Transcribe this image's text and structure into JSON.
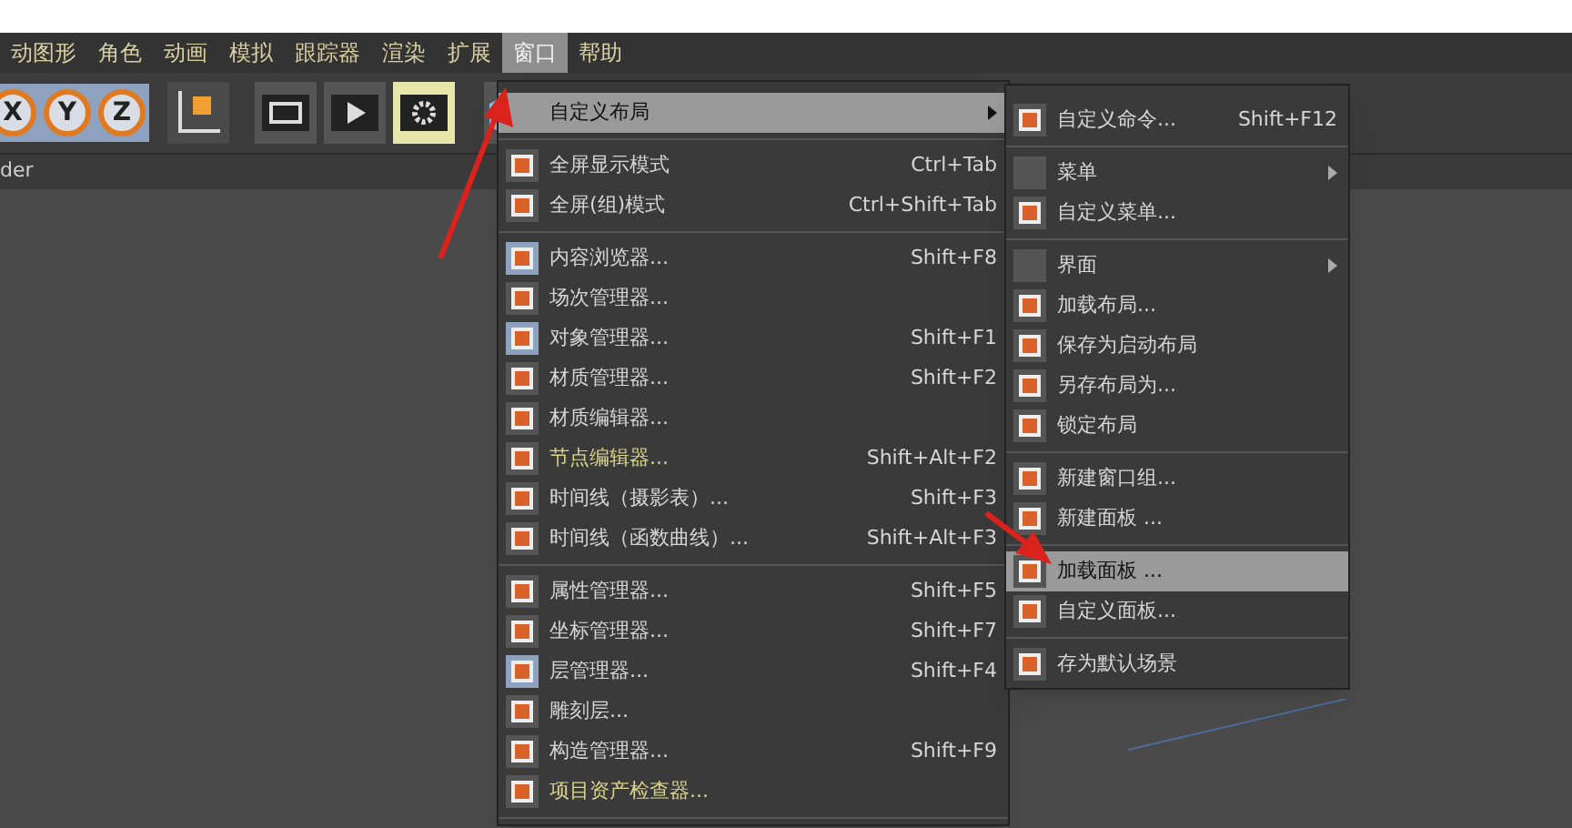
{
  "menubar": [
    {
      "label": "动图形",
      "selected": false
    },
    {
      "label": "角色",
      "selected": false
    },
    {
      "label": "动画",
      "selected": false
    },
    {
      "label": "模拟",
      "selected": false
    },
    {
      "label": "跟踪器",
      "selected": false
    },
    {
      "label": "渲染",
      "selected": false
    },
    {
      "label": "扩展",
      "selected": false
    },
    {
      "label": "窗口",
      "selected": true
    },
    {
      "label": "帮助",
      "selected": false
    }
  ],
  "toolbar": {
    "axis_buttons": [
      "X",
      "Y",
      "Z"
    ]
  },
  "panel_label": "der",
  "window_menu": [
    {
      "kind": "submenu",
      "label": "自定义布局",
      "selected": true,
      "accent": false
    },
    {
      "kind": "separator"
    },
    {
      "kind": "command",
      "label": "全屏显示模式",
      "shortcut": "Ctrl+Tab",
      "selected": false,
      "checked": false,
      "accent": false
    },
    {
      "kind": "command",
      "label": "全屏(组)模式",
      "shortcut": "Ctrl+Shift+Tab",
      "selected": false,
      "checked": false,
      "accent": false
    },
    {
      "kind": "separator"
    },
    {
      "kind": "command",
      "label": "内容浏览器...",
      "shortcut": "Shift+F8",
      "selected": false,
      "checked": true,
      "accent": false
    },
    {
      "kind": "command",
      "label": "场次管理器...",
      "selected": false,
      "checked": false,
      "accent": false
    },
    {
      "kind": "command",
      "label": "对象管理器...",
      "shortcut": "Shift+F1",
      "selected": false,
      "checked": true,
      "accent": false
    },
    {
      "kind": "command",
      "label": "材质管理器...",
      "shortcut": "Shift+F2",
      "selected": false,
      "checked": false,
      "accent": false
    },
    {
      "kind": "command",
      "label": "材质编辑器...",
      "selected": false,
      "checked": false,
      "accent": false
    },
    {
      "kind": "command",
      "label": "节点编辑器...",
      "shortcut": "Shift+Alt+F2",
      "selected": false,
      "checked": false,
      "accent": true
    },
    {
      "kind": "command",
      "label": "时间线（摄影表）...",
      "shortcut": "Shift+F3",
      "selected": false,
      "checked": false,
      "accent": false
    },
    {
      "kind": "command",
      "label": "时间线（函数曲线）...",
      "shortcut": "Shift+Alt+F3",
      "selected": false,
      "checked": false,
      "accent": false
    },
    {
      "kind": "separator"
    },
    {
      "kind": "command",
      "label": "属性管理器...",
      "shortcut": "Shift+F5",
      "selected": false,
      "checked": false,
      "accent": false
    },
    {
      "kind": "command",
      "label": "坐标管理器...",
      "shortcut": "Shift+F7",
      "selected": false,
      "checked": false,
      "accent": false
    },
    {
      "kind": "command",
      "label": "层管理器...",
      "shortcut": "Shift+F4",
      "selected": false,
      "checked": true,
      "accent": false
    },
    {
      "kind": "command",
      "label": "雕刻层...",
      "selected": false,
      "checked": false,
      "accent": false
    },
    {
      "kind": "command",
      "label": "构造管理器...",
      "shortcut": "Shift+F9",
      "selected": false,
      "checked": false,
      "accent": false
    },
    {
      "kind": "command",
      "label": "项目资产检查器...",
      "selected": false,
      "checked": false,
      "accent": true
    },
    {
      "kind": "separator"
    }
  ],
  "layout_submenu": [
    {
      "kind": "command",
      "label": "自定义命令...",
      "shortcut": "Shift+F12",
      "selected": false
    },
    {
      "kind": "separator"
    },
    {
      "kind": "submenu",
      "label": "菜单",
      "selected": false
    },
    {
      "kind": "command",
      "label": "自定义菜单...",
      "selected": false
    },
    {
      "kind": "separator"
    },
    {
      "kind": "submenu",
      "label": "界面",
      "selected": false
    },
    {
      "kind": "command",
      "label": "加载布局...",
      "selected": false
    },
    {
      "kind": "command",
      "label": "保存为启动布局",
      "selected": false
    },
    {
      "kind": "command",
      "label": "另存布局为...",
      "selected": false
    },
    {
      "kind": "command",
      "label": "锁定布局",
      "selected": false
    },
    {
      "kind": "separator"
    },
    {
      "kind": "command",
      "label": "新建窗口组...",
      "selected": false
    },
    {
      "kind": "command",
      "label": "新建面板 ...",
      "selected": false
    },
    {
      "kind": "separator"
    },
    {
      "kind": "command",
      "label": "加载面板 ...",
      "selected": true
    },
    {
      "kind": "command",
      "label": "自定义面板...",
      "selected": false
    },
    {
      "kind": "separator"
    },
    {
      "kind": "command",
      "label": "存为默认场景",
      "selected": false
    }
  ]
}
